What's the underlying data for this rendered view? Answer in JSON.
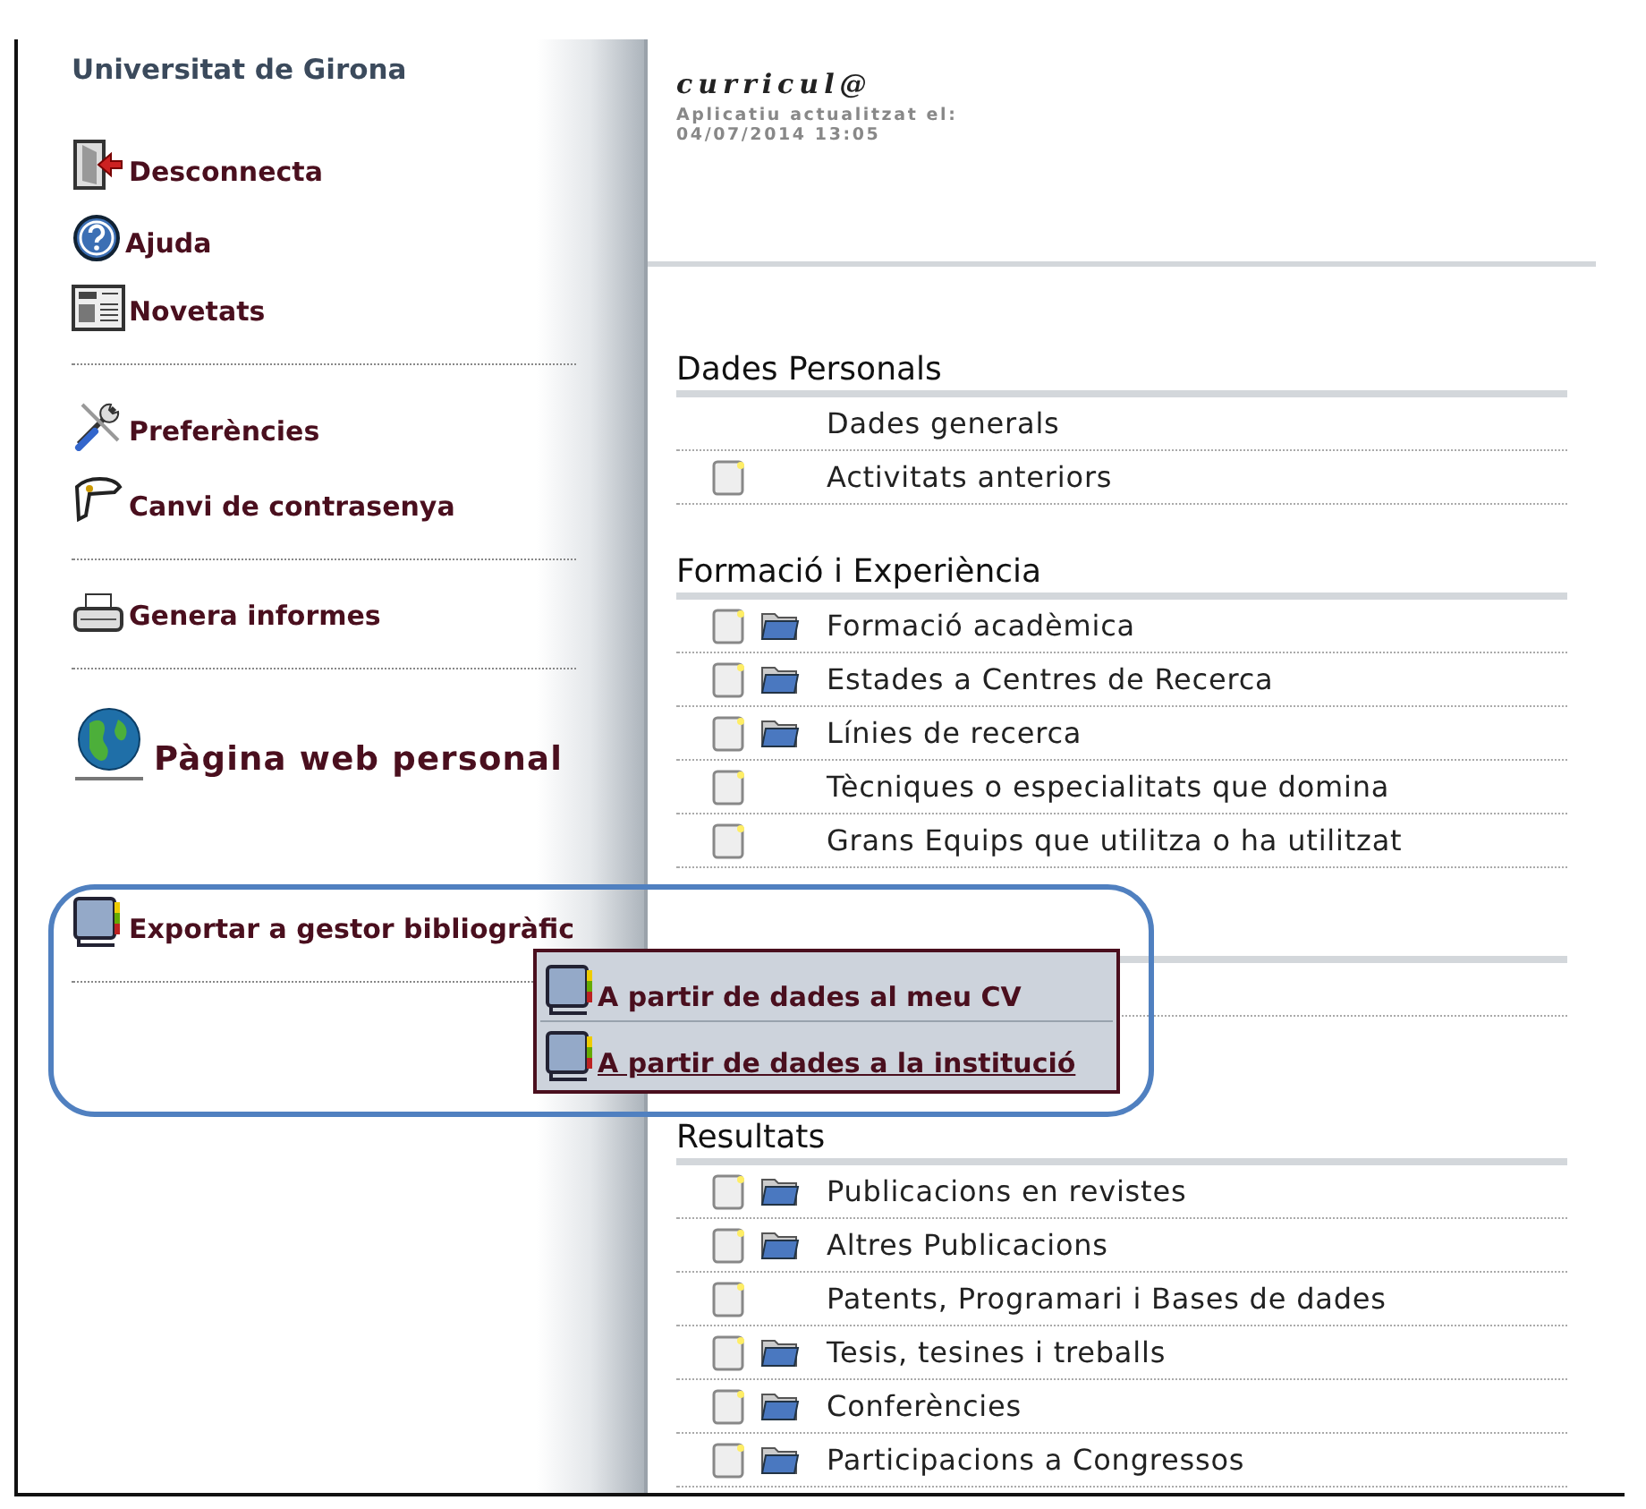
{
  "sidebar": {
    "title": "Universitat de Girona",
    "groups": [
      {
        "items": [
          {
            "label": "Desconnecta",
            "kind": "link"
          },
          {
            "label": "Ajuda",
            "kind": "link"
          },
          {
            "label": "Novetats",
            "kind": "link"
          }
        ]
      },
      {
        "items": [
          {
            "label": "Preferències",
            "kind": "link"
          },
          {
            "label": "Canvi de contrasenya",
            "kind": "link"
          }
        ]
      },
      {
        "items": [
          {
            "label": "Genera informes",
            "kind": "link"
          }
        ]
      },
      {
        "items": [
          {
            "label": "Pàgina web personal",
            "kind": "large"
          }
        ]
      },
      {
        "items": [
          {
            "label": "Exportar a gestor bibliogràfic",
            "kind": "link"
          }
        ]
      }
    ]
  },
  "export_menu": {
    "items": [
      {
        "label": "A partir de dades al meu CV",
        "hovered": false
      },
      {
        "label": "A partir de dades a la institució",
        "hovered": true
      }
    ]
  },
  "header": {
    "app_name": "curricul@",
    "updated_label": "Aplicatiu actualitzat el:",
    "updated_date": "04/07/2014 13:05"
  },
  "sections": [
    {
      "title": "Dades Personals",
      "items": [
        {
          "label": "Dades generals",
          "document": false,
          "folder": false
        },
        {
          "label": "Activitats anteriors",
          "document": true,
          "folder": false
        }
      ]
    },
    {
      "title": "Formació i Experiència",
      "items": [
        {
          "label": "Formació acadèmica",
          "document": true,
          "folder": true
        },
        {
          "label": "Estades a Centres de Recerca",
          "document": true,
          "folder": true
        },
        {
          "label": "Línies de recerca",
          "document": true,
          "folder": true
        },
        {
          "label": "Tècniques o especialitats que domina",
          "document": true,
          "folder": false
        },
        {
          "label": "Grans Equips que utilitza o ha utilitzat",
          "document": true,
          "folder": false
        }
      ]
    },
    {
      "title": "Resultats",
      "items": [
        {
          "label": "Publicacions en revistes",
          "document": true,
          "folder": true
        },
        {
          "label": "Altres Publicacions",
          "document": true,
          "folder": true
        },
        {
          "label": "Patents, Programari i Bases de dades",
          "document": true,
          "folder": false
        },
        {
          "label": "Tesis, tesines i treballs",
          "document": true,
          "folder": true
        },
        {
          "label": "Conferències",
          "document": true,
          "folder": true
        },
        {
          "label": "Participacions a Congressos",
          "document": true,
          "folder": true
        }
      ]
    }
  ]
}
